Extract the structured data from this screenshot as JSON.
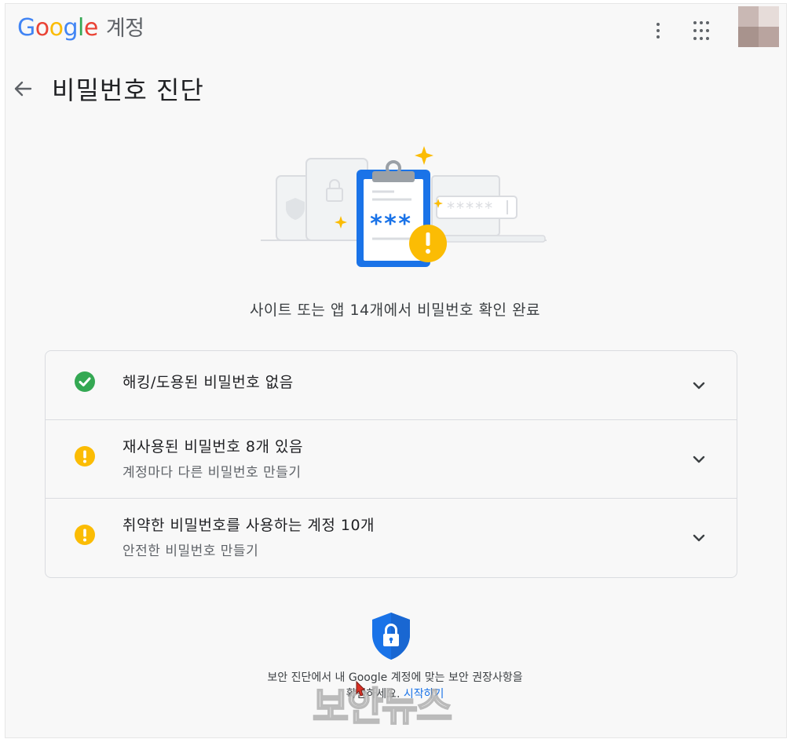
{
  "header": {
    "logo_google": [
      "G",
      "o",
      "o",
      "g",
      "l",
      "e"
    ],
    "logo_suffix": "계정"
  },
  "page": {
    "title": "비밀번호 진단",
    "summary": "사이트 또는 앱 14개에서 비밀번호 확인 완료"
  },
  "hero": {
    "password_mask": "*****",
    "clipboard_mask": "***"
  },
  "results": [
    {
      "title": "해킹/도용된 비밀번호 없음",
      "subtitle": "",
      "status": "ok"
    },
    {
      "title": "재사용된 비밀번호 8개 있음",
      "subtitle": "계정마다 다른 비밀번호 만들기",
      "status": "warning"
    },
    {
      "title": "취약한 비밀번호를 사용하는 계정 10개",
      "subtitle": "안전한 비밀번호 만들기",
      "status": "warning"
    }
  ],
  "footer": {
    "line1": "보안 진단에서 내 Google 계정에 맞는 보안 권장사항을",
    "line2_prefix": "확인하세요.",
    "link": "시작하기"
  },
  "watermark": "보안뉴스",
  "colors": {
    "ok": "#34A853",
    "warning": "#FBBC04",
    "blue": "#1a73e8"
  }
}
